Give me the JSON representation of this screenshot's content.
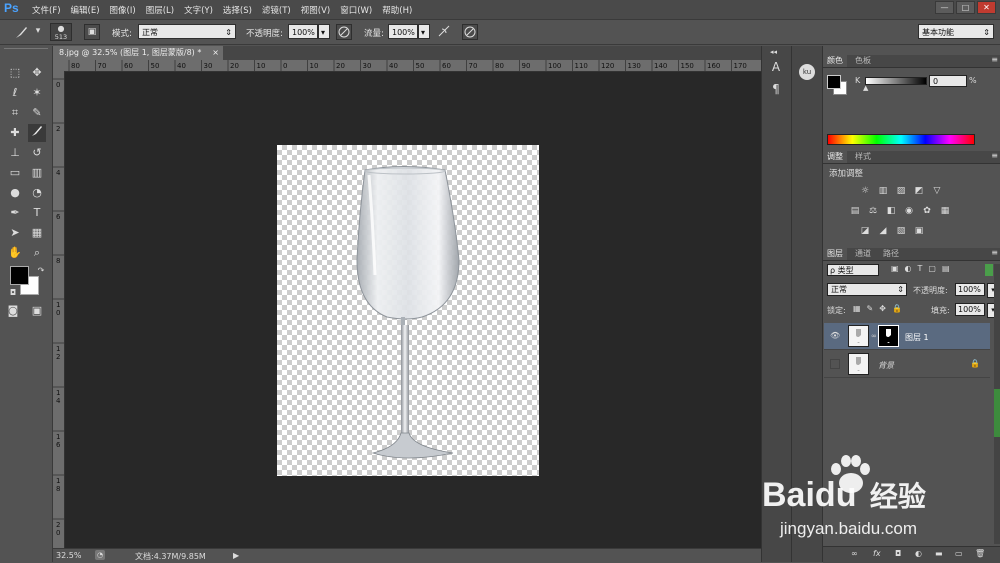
{
  "app": {
    "logo": "Ps"
  },
  "menu": [
    "文件(F)",
    "编辑(E)",
    "图像(I)",
    "图层(L)",
    "文字(Y)",
    "选择(S)",
    "滤镜(T)",
    "视图(V)",
    "窗口(W)",
    "帮助(H)"
  ],
  "window_buttons": {
    "minimize": "—",
    "restore": "□",
    "close": "✕"
  },
  "options_bar": {
    "brush_size": "513",
    "mode_label": "模式:",
    "mode_value": "正常",
    "opacity_label": "不透明度:",
    "opacity_value": "100%",
    "flow_label": "流量:",
    "flow_value": "100%",
    "workspace_value": "基本功能"
  },
  "document": {
    "tab_title": "8.jpg @ 32.5% (图层 1, 图层蒙版/8) *",
    "tab_close": "×",
    "ruler_h": [
      "80",
      "70",
      "60",
      "50",
      "40",
      "30",
      "20",
      "10",
      "0",
      "10",
      "20",
      "30",
      "40",
      "50",
      "60",
      "70",
      "80",
      "90",
      "100",
      "110",
      "120",
      "130",
      "140",
      "150",
      "160",
      "170"
    ],
    "ruler_v": [
      "0",
      "2",
      "4",
      "6",
      "8",
      "1 0",
      "1 2",
      "1 4",
      "1 6",
      "1 8",
      "2 0"
    ],
    "colors": {
      "canvas_bg": "#282828",
      "ui_bg": "#535353",
      "accent": "#4aa3ff",
      "selected_layer": "#5a6a80"
    }
  },
  "status": {
    "zoom": "32.5%",
    "doc_info": "文档:4.37M/9.85M"
  },
  "color_panel": {
    "tabs": [
      "颜色",
      "色板"
    ],
    "channel_label": "K",
    "value": "0",
    "unit": "%"
  },
  "adjust_panel": {
    "tabs": [
      "调整",
      "样式"
    ],
    "title": "添加调整",
    "row1": [
      "☼",
      "▥",
      "▨",
      "◩",
      "▽"
    ],
    "row2": [
      "▤",
      "⚖",
      "◧",
      "◉",
      "✿",
      "▦"
    ],
    "row3": [
      "◪",
      "◢",
      "▧",
      "▣"
    ]
  },
  "layers_panel": {
    "tabs": [
      "图层",
      "通道",
      "路径"
    ],
    "filter_label": "ρ 类型",
    "blend_mode": "正常",
    "opacity_label": "不透明度:",
    "opacity_value": "100%",
    "lock_label": "锁定:",
    "fill_label": "填充:",
    "fill_value": "100%",
    "layers": [
      {
        "name": "图层 1",
        "visible": true,
        "selected": true
      },
      {
        "name": "背景",
        "visible": false,
        "locked": true
      }
    ],
    "footer_icons": [
      "∞",
      "fx",
      "◘",
      "◐",
      "▬",
      "▭",
      "🗑"
    ]
  },
  "watermark": {
    "brand": "Bai",
    "brand2": "du",
    "cn": "经验",
    "url": "jingyan.baidu.com"
  }
}
